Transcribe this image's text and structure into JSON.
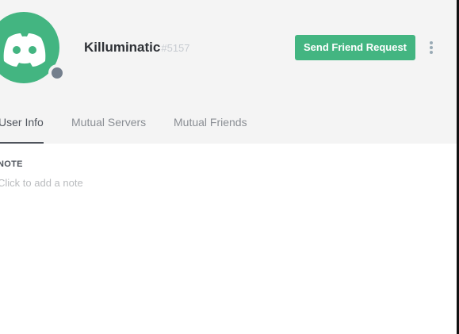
{
  "profile": {
    "username": "Killuminatic",
    "discriminator": "#5157",
    "status": "offline",
    "avatar_icon": "discord-logo-icon"
  },
  "actions": {
    "send_friend_request_label": "Send Friend Request",
    "more_icon": "more-vertical-icon"
  },
  "tabs": [
    {
      "label": "User Info",
      "active": true
    },
    {
      "label": "Mutual Servers",
      "active": false
    },
    {
      "label": "Mutual Friends",
      "active": false
    }
  ],
  "note": {
    "label": "NOTE",
    "placeholder": "Click to add a note"
  },
  "colors": {
    "brand_green": "#43b581",
    "header_bg": "#f4f4f4",
    "status_offline": "#747f8d"
  }
}
